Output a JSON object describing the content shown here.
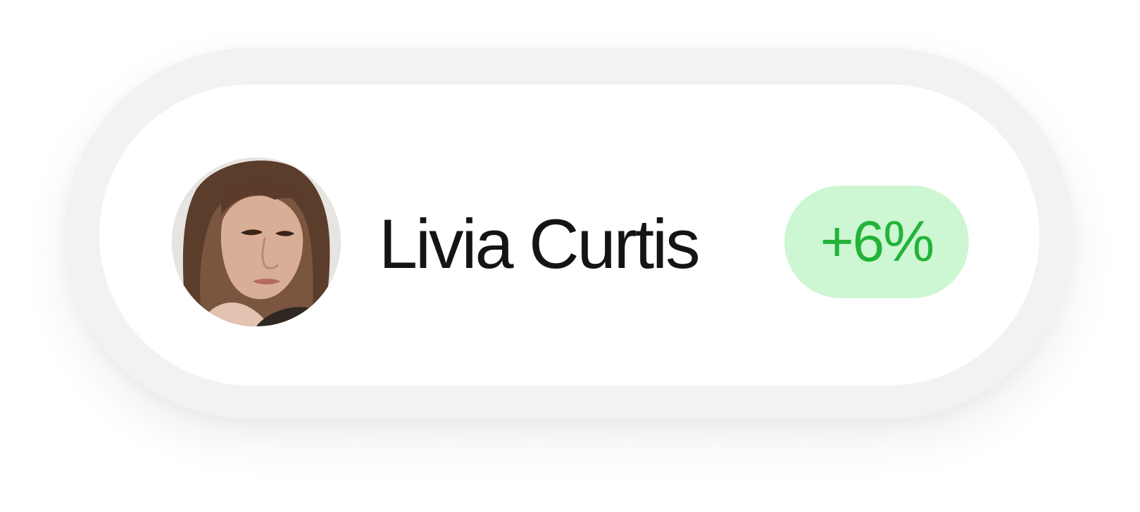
{
  "profile": {
    "name": "Livia Curtis",
    "avatar_icon": "user-avatar-photo"
  },
  "change": {
    "value": "+6%",
    "color": "#22b338",
    "background": "#cdf6d2"
  }
}
